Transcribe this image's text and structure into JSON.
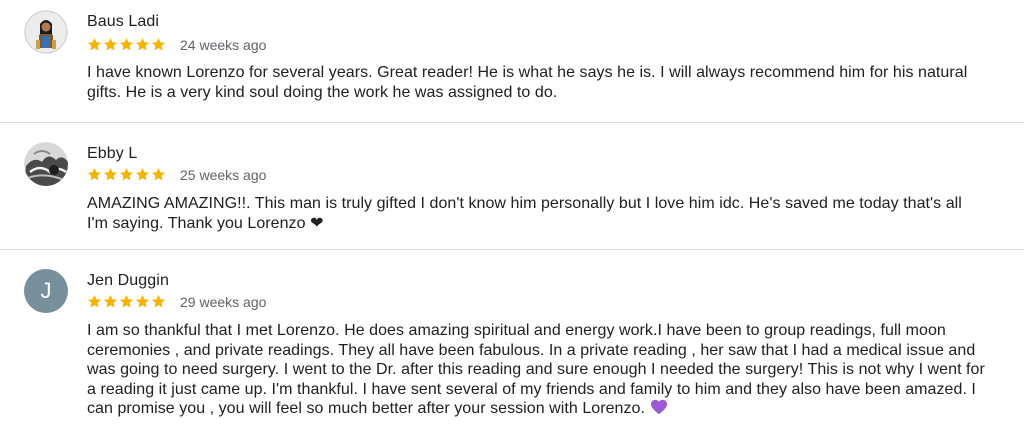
{
  "reviews": [
    {
      "name": "Baus Ladi",
      "avatar": "photo-avatar",
      "rating": 5,
      "time": "24 weeks ago",
      "text": "I have known Lorenzo for several years. Great reader! He is what he says he is. I will always recommend him for his natural gifts. He is a very kind soul doing the work he was assigned to do."
    },
    {
      "name": "Ebby L",
      "avatar": "photo-avatar",
      "rating": 5,
      "time": "25 weeks ago",
      "text": "AMAZING AMAZING!!. This man is truly gifted I don't know him personally but I love him idc. He's saved me today that's all I'm saying. Thank you Lorenzo",
      "emoji": "❤"
    },
    {
      "name": "Jen Duggin",
      "avatar_letter": "J",
      "rating": 5,
      "time": "29 weeks ago",
      "text": "I am so thankful that I met Lorenzo. He does amazing spiritual and energy work.I have been to group readings, full moon ceremonies , and private readings. They all have been fabulous. In a private reading , her saw that I had a medical issue and was going to need surgery. I went to the Dr. after this reading and sure enough I needed the surgery! This is not why I went for a reading it just came up. I'm thankful. I have sent several of my friends and family to him and they also have been amazed. I can promise you , you will feel so much better after your session with Lorenzo.",
      "emoji": "purple-heart-icon"
    }
  ],
  "colors": {
    "star": "#f4b400",
    "divider": "#dadce0",
    "secondary_text": "#5f6368",
    "avatar_letter_bg": "#78909c",
    "purple_heart": "#9b59d6"
  }
}
